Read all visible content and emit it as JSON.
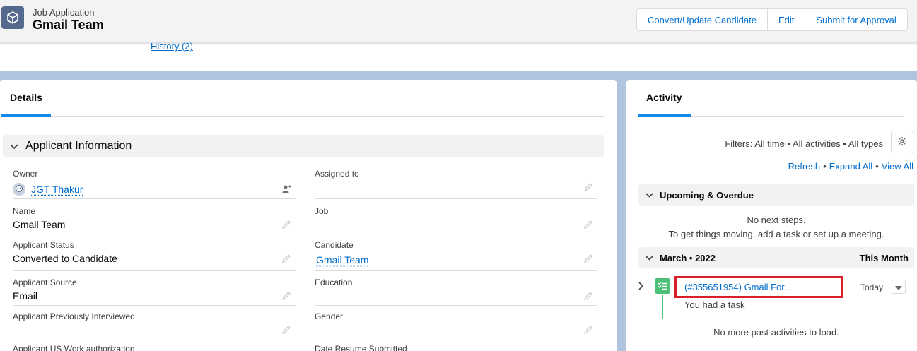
{
  "header": {
    "object_type": "Job Application",
    "record_name": "Gmail Team",
    "buttons": [
      "Convert/Update Candidate",
      "Edit",
      "Submit for Approval"
    ]
  },
  "related": {
    "history_link": "History (2)"
  },
  "details": {
    "tab": "Details",
    "section_title": "Applicant Information",
    "fields": {
      "owner": {
        "label": "Owner",
        "value": "JGT Thakur"
      },
      "assigned_to": {
        "label": "Assigned to",
        "value": ""
      },
      "name": {
        "label": "Name",
        "value": "Gmail Team"
      },
      "job": {
        "label": "Job",
        "value": ""
      },
      "applicant_status": {
        "label": "Applicant Status",
        "value": "Converted to Candidate"
      },
      "candidate": {
        "label": "Candidate",
        "value": "Gmail Team"
      },
      "applicant_source": {
        "label": "Applicant Source",
        "value": "Email"
      },
      "education": {
        "label": "Education",
        "value": ""
      },
      "previously_interviewed": {
        "label": "Applicant Previously Interviewed",
        "value": ""
      },
      "gender": {
        "label": "Gender",
        "value": ""
      },
      "us_work_auth": {
        "label": "Applicant US Work authorization",
        "value": ""
      },
      "date_resume": {
        "label": "Date Resume Submitted",
        "value": ""
      }
    }
  },
  "activity": {
    "tab": "Activity",
    "filters": "Filters: All time • All activities • All types",
    "links": {
      "refresh": "Refresh",
      "expand_all": "Expand All",
      "view_all": "View All"
    },
    "upcoming": {
      "title": "Upcoming & Overdue",
      "empty_line1": "No next steps.",
      "empty_line2": "To get things moving, add a task or set up a meeting."
    },
    "month": {
      "title": "March • 2022",
      "right": "This Month"
    },
    "task": {
      "title": "(#355651954) Gmail For...",
      "subtitle": "You had a task",
      "date": "Today"
    },
    "no_more": "No more past activities to load."
  },
  "colors": {
    "accent_link": "#006dcc",
    "tab_underline": "#1589ee",
    "task_green": "#4bc076",
    "highlight_red": "#d9202a"
  }
}
